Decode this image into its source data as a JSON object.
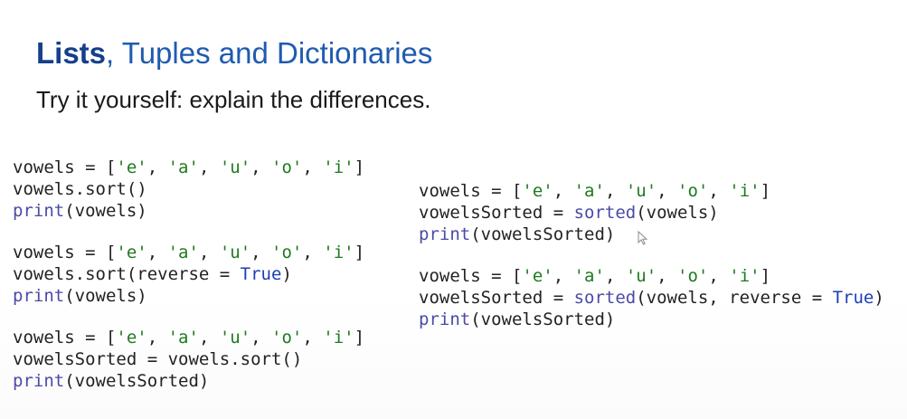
{
  "slide": {
    "title_bold": "Lists",
    "title_rest": ", Tuples and Dictionaries",
    "subtitle": "Try it yourself: explain the differences."
  },
  "colors": {
    "title": "#1f5bb0",
    "string": "#1f7a1f",
    "keyword": "#1b3fb5",
    "text": "#222222"
  },
  "code_left": [
    {
      "lines": [
        "vowels = ['e', 'a', 'u', 'o', 'i']",
        "vowels.sort()",
        "print(vowels)"
      ]
    },
    {
      "lines": [
        "vowels = ['e', 'a', 'u', 'o', 'i']",
        "vowels.sort(reverse = True)",
        "print(vowels)"
      ]
    },
    {
      "lines": [
        "vowels = ['e', 'a', 'u', 'o', 'i']",
        "vowelsSorted = vowels.sort()",
        "print(vowelsSorted)"
      ]
    }
  ],
  "code_right": [
    {
      "lines": [
        "vowels = ['e', 'a', 'u', 'o', 'i']",
        "vowelsSorted = sorted(vowels)",
        "print(vowelsSorted)"
      ]
    },
    {
      "lines": [
        "vowels = ['e', 'a', 'u', 'o', 'i']",
        "vowelsSorted = sorted(vowels, reverse = True)",
        "print(vowelsSorted)"
      ]
    }
  ],
  "cursor": {
    "icon": "mouse-pointer-icon"
  }
}
